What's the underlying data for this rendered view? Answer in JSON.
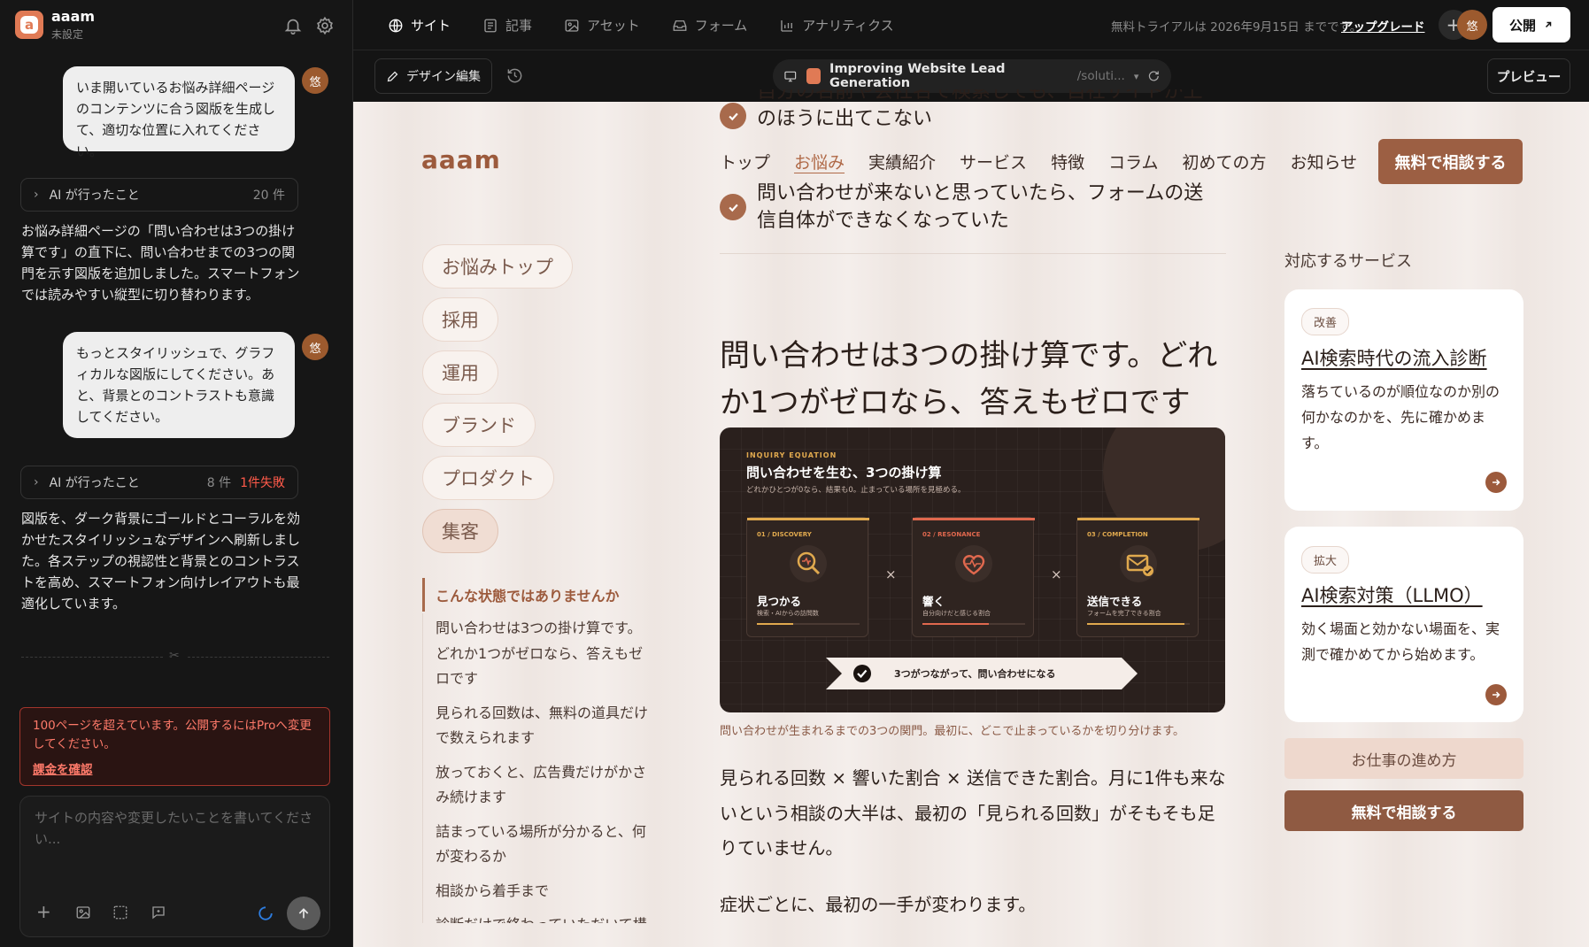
{
  "app": {
    "name": "aaam",
    "status": "未設定",
    "logo_letter": "a"
  },
  "chat": {
    "user_avatar": "悠",
    "messages": [
      {
        "role": "user",
        "text": "いま開いているお悩み詳細ページのコンテンツに合う図版を生成して、適切な位置に入れてください。"
      },
      {
        "role": "ai_actions",
        "label": "AI が行ったこと",
        "count": "20 件"
      },
      {
        "role": "ai",
        "text": "お悩み詳細ページの「問い合わせは3つの掛け算です」の直下に、問い合わせまでの3つの関門を示す図版を追加しました。スマートフォンでは読みやすい縦型に切り替わります。"
      },
      {
        "role": "user",
        "text": "もっとスタイリッシュで、グラフィカルな図版にしてください。あと、背景とのコントラストも意識してください。"
      },
      {
        "role": "ai_actions",
        "label": "AI が行ったこと",
        "count": "8 件",
        "fail": "1件失敗"
      },
      {
        "role": "ai",
        "text": "図版を、ダーク背景にゴールドとコーラルを効かせたスタイリッシュなデザインへ刷新しました。各ステップの視認性と背景とのコントラストを高め、スマートフォン向けレイアウトも最適化しています。"
      }
    ],
    "warning": {
      "text": "100ページを超えています。公開するにはProへ変更してください。",
      "link": "課金を確認"
    },
    "input": {
      "placeholder": "サイトの内容や変更したいことを書いてください..."
    }
  },
  "topnav": {
    "tabs": [
      {
        "label": "サイト",
        "icon": "globe-icon",
        "active": true
      },
      {
        "label": "記事",
        "icon": "article-icon"
      },
      {
        "label": "アセット",
        "icon": "image-icon"
      },
      {
        "label": "フォーム",
        "icon": "inbox-icon"
      },
      {
        "label": "アナリティクス",
        "icon": "chart-icon"
      }
    ],
    "trial": "無料トライアルは 2026年9月15日 までです。",
    "upgrade": "アップグレード",
    "avatar": "悠",
    "publish": "公開"
  },
  "toolbar": {
    "design_edit": "デザイン編集",
    "page_title": "Improving Website Lead Generation",
    "page_path": "/soluti...",
    "preview": "プレビュー"
  },
  "site": {
    "logo": "aaam",
    "nav": [
      "トップ",
      "お悩み",
      "実績紹介",
      "サービス",
      "特徴",
      "コラム",
      "初めての方",
      "お知らせ"
    ],
    "cta": "無料で相談する",
    "checklist": [
      "自分の名前や会社名で検索しても、自社サイトが上のほうに出てこない",
      "問い合わせが来ないと思っていたら、フォームの送信自体ができなくなっていた"
    ],
    "categories": [
      "お悩みトップ",
      "採用",
      "運用",
      "ブランド",
      "プロダクト",
      "集客"
    ],
    "toc_heading": "こんな状態ではありませんか",
    "toc": [
      "問い合わせは3つの掛け算です。どれか1つがゼロなら、答えもゼロです",
      "見られる回数は、無料の道具だけで数えられます",
      "放っておくと、広告費だけがかさみ続けます",
      "詰まっている場所が分かると、何が変わるか",
      "相談から着手まで",
      "診断だけで終わっていただいて構い"
    ],
    "heading": "問い合わせは3つの掛け算です。どれか1つがゼロなら、答えもゼロです",
    "figure": {
      "eyebrow": "INQUIRY EQUATION",
      "title": "問い合わせを生む、3つの掛け算",
      "subtitle": "どれかひとつが0なら、結果も0。止まっている場所を見極める。",
      "steps": [
        {
          "tag": "01 / DISCOVERY",
          "title": "見つかる",
          "desc": "検索・AIからの訪問数",
          "icon": "magnifier-icon",
          "level": 0.35
        },
        {
          "tag": "02 / RESONANCE",
          "title": "響く",
          "desc": "自分向けだと感じる割合",
          "icon": "heart-pulse-icon",
          "level": 0.65
        },
        {
          "tag": "03 / COMPLETION",
          "title": "送信できる",
          "desc": "フォームを完了できる割合",
          "icon": "mail-check-icon",
          "level": 0.95
        }
      ],
      "operator": "×",
      "banner": "3つがつながって、問い合わせになる",
      "colors": {
        "gold": "#e0a94e",
        "coral": "#e0684e",
        "dark": "#2a201d"
      }
    },
    "caption": "問い合わせが生まれるまでの3つの関門。最初に、どこで止まっているかを切り分けます。",
    "body": "見られる回数 × 響いた割合 × 送信できた割合。月に1件も来ないという相談の大半は、最初の「見られる回数」がそもそも足りていません。",
    "body2": "症状ごとに、最初の一手が変わります。",
    "services_heading": "対応するサービス",
    "services": [
      {
        "tag": "改善",
        "title": "AI検索時代の流入診断",
        "desc": "落ちているのが順位なのか別の何かなのかを、先に確かめます。"
      },
      {
        "tag": "拡大",
        "title": "AI検索対策（LLMO）",
        "desc": "効く場面と効かない場面を、実測で確かめてから始めます。"
      }
    ],
    "flow_button": "お仕事の進め方",
    "consult_button": "無料で相談する"
  }
}
